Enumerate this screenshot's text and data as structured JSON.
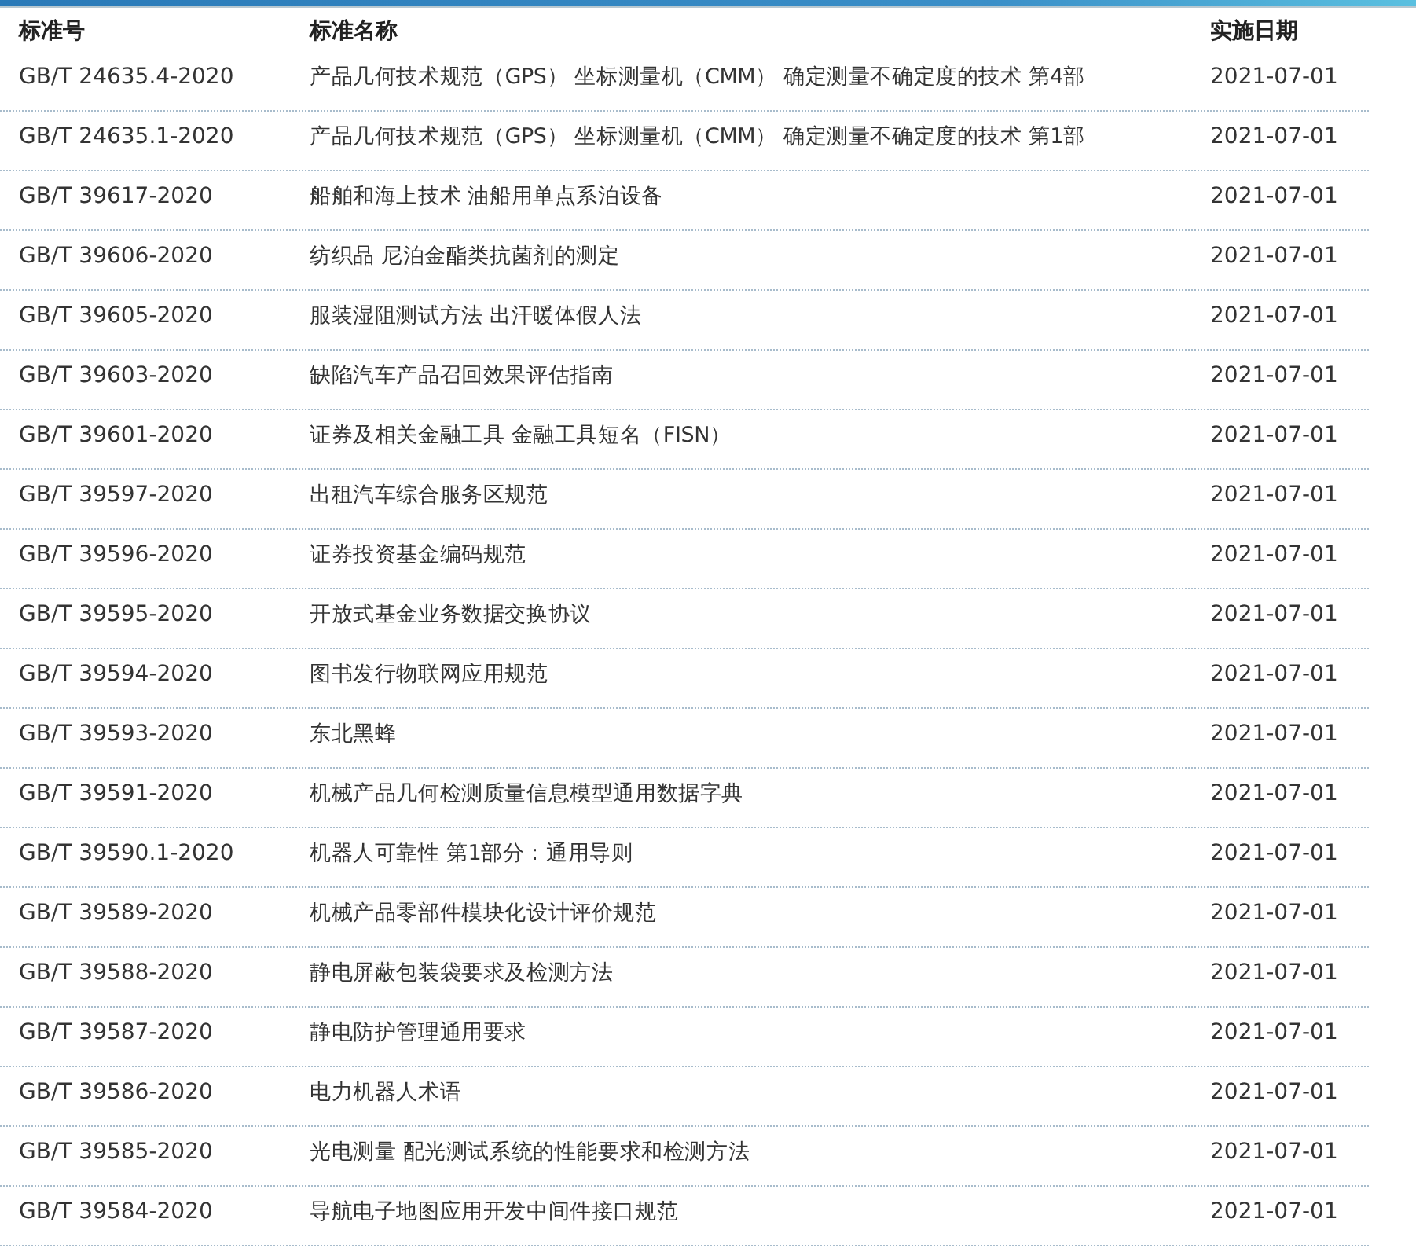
{
  "table": {
    "columns": [
      "标准号",
      "标准名称",
      "实施日期"
    ],
    "rows": [
      {
        "code": "GB/T 24635.4-2020",
        "name": "产品几何技术规范（GPS） 坐标测量机（CMM） 确定测量不确定度的技术 第4部",
        "date": "2021-07-01"
      },
      {
        "code": "GB/T 24635.1-2020",
        "name": "产品几何技术规范（GPS） 坐标测量机（CMM） 确定测量不确定度的技术 第1部",
        "date": "2021-07-01"
      },
      {
        "code": "GB/T 39617-2020",
        "name": "船舶和海上技术 油船用单点系泊设备",
        "date": "2021-07-01"
      },
      {
        "code": "GB/T 39606-2020",
        "name": "纺织品 尼泊金酯类抗菌剂的测定",
        "date": "2021-07-01"
      },
      {
        "code": "GB/T 39605-2020",
        "name": "服装湿阻测试方法 出汗暖体假人法",
        "date": "2021-07-01"
      },
      {
        "code": "GB/T 39603-2020",
        "name": "缺陷汽车产品召回效果评估指南",
        "date": "2021-07-01"
      },
      {
        "code": "GB/T 39601-2020",
        "name": "证券及相关金融工具 金融工具短名（FISN）",
        "date": "2021-07-01"
      },
      {
        "code": "GB/T 39597-2020",
        "name": "出租汽车综合服务区规范",
        "date": "2021-07-01"
      },
      {
        "code": "GB/T 39596-2020",
        "name": "证券投资基金编码规范",
        "date": "2021-07-01"
      },
      {
        "code": "GB/T 39595-2020",
        "name": "开放式基金业务数据交换协议",
        "date": "2021-07-01"
      },
      {
        "code": "GB/T 39594-2020",
        "name": "图书发行物联网应用规范",
        "date": "2021-07-01"
      },
      {
        "code": "GB/T 39593-2020",
        "name": "东北黑蜂",
        "date": "2021-07-01"
      },
      {
        "code": "GB/T 39591-2020",
        "name": "机械产品几何检测质量信息模型通用数据字典",
        "date": "2021-07-01"
      },
      {
        "code": "GB/T 39590.1-2020",
        "name": "机器人可靠性 第1部分：通用导则",
        "date": "2021-07-01"
      },
      {
        "code": "GB/T 39589-2020",
        "name": "机械产品零部件模块化设计评价规范",
        "date": "2021-07-01"
      },
      {
        "code": "GB/T 39588-2020",
        "name": "静电屏蔽包装袋要求及检测方法",
        "date": "2021-07-01"
      },
      {
        "code": "GB/T 39587-2020",
        "name": "静电防护管理通用要求",
        "date": "2021-07-01"
      },
      {
        "code": "GB/T 39586-2020",
        "name": "电力机器人术语",
        "date": "2021-07-01"
      },
      {
        "code": "GB/T 39585-2020",
        "name": "光电测量 配光测试系统的性能要求和检测方法",
        "date": "2021-07-01"
      },
      {
        "code": "GB/T 39584-2020",
        "name": "导航电子地图应用开发中间件接口规范",
        "date": "2021-07-01"
      }
    ]
  }
}
